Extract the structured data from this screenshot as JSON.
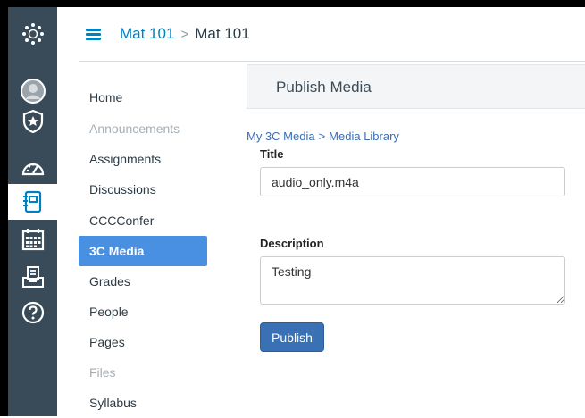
{
  "header": {
    "course_link": "Mat 101",
    "separator": ">",
    "current": "Mat 101"
  },
  "global_nav": {
    "icons": [
      "canvas-logo-icon",
      "account-icon",
      "admin-icon",
      "dashboard-icon",
      "courses-icon",
      "calendar-icon",
      "inbox-icon",
      "help-icon"
    ]
  },
  "course_nav": {
    "items": [
      {
        "label": "Home",
        "state": "normal"
      },
      {
        "label": "Announcements",
        "state": "disabled"
      },
      {
        "label": "Assignments",
        "state": "normal"
      },
      {
        "label": "Discussions",
        "state": "normal"
      },
      {
        "label": "CCCConfer",
        "state": "normal"
      },
      {
        "label": "3C Media",
        "state": "active"
      },
      {
        "label": "Grades",
        "state": "normal"
      },
      {
        "label": "People",
        "state": "normal"
      },
      {
        "label": "Pages",
        "state": "normal"
      },
      {
        "label": "Files",
        "state": "disabled"
      },
      {
        "label": "Syllabus",
        "state": "normal"
      }
    ]
  },
  "main": {
    "heading": "Publish Media",
    "breadcrumb": {
      "first": "My 3C Media",
      "sep": ">",
      "second": "Media Library"
    },
    "title_label": "Title",
    "title_value": "audio_only.m4a",
    "description_label": "Description",
    "description_value": "Testing",
    "publish_button": "Publish"
  },
  "colors": {
    "nav_bg": "#394b58",
    "link": "#0081bd",
    "active_item": "#4a90e2",
    "button": "#3a71b4"
  }
}
